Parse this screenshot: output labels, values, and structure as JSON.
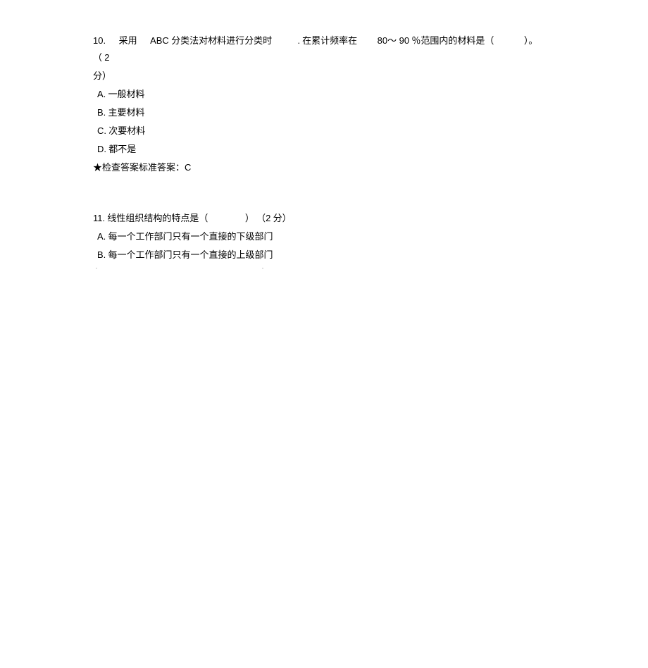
{
  "q10": {
    "number": "10.",
    "text_pre": "采用",
    "abc": "ABC",
    "text_mid1": "分类法对材料进行分类时",
    "text_mid2": ". 在累计频率在",
    "range": "80～ 90",
    "text_after": "％范围内的材料是（",
    "paren_close": "）。",
    "paren_points_open": "（",
    "points_num": "2",
    "points_close": "分）",
    "options": {
      "a_letter": "A.",
      "a_text": "一般材料",
      "b_letter": "B.",
      "b_text": "主要材料",
      "c_letter": "C.",
      "c_text": "次要材料",
      "d_letter": "D.",
      "d_text": "都不是"
    },
    "answer_label": "★检查答案标准答案：",
    "answer_value": "C"
  },
  "q11": {
    "number": "11.",
    "text": "线性组织结构的特点是（",
    "paren_close": "）",
    "paren_points_open": "（",
    "points_num": "2",
    "points_close": "分）",
    "options": {
      "a_letter": "A.",
      "a_text": "每一个工作部门只有一个直接的下级部门",
      "b_letter": "B.",
      "b_text": "每一个工作部门只有一个直接的上级部门"
    }
  },
  "footer": {
    "dot1": ".",
    "dot2": "."
  }
}
